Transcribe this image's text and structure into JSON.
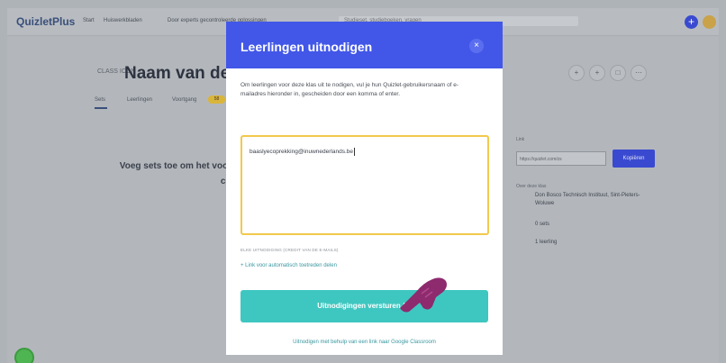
{
  "app": {
    "logo": "QuizletPlus"
  },
  "nav": {
    "links": [
      "Start",
      "Huiswerkbladen",
      "Door experts gecontroleerde oplossingen"
    ],
    "search_placeholder": "Studieset, studieboeken, vragen",
    "plus_icon": "plus-icon"
  },
  "page": {
    "class_icon_text": "CLASS ICON",
    "title": "Naam van de",
    "tabs": [
      "Sets",
      "Leerlingen",
      "Voortgang"
    ],
    "badge": "58",
    "right_icon_glyphs": [
      "+",
      "+",
      "□",
      "⋯"
    ],
    "empty_line1": "Voeg sets toe om het voo",
    "empty_line2": "cont",
    "side_label": "Link",
    "share_link": "https://quizlet.com/zs",
    "copy_label": "Kopiëren",
    "side_sub": "Over deze klas",
    "info": [
      "Don Bosco Technisch Instituut, Sint-Pieters-Woluwe",
      "0 sets",
      "1 leerling"
    ]
  },
  "modal": {
    "title": "Leerlingen uitnodigen",
    "close_glyph": "×",
    "instructions": "Om leerlingen voor deze klas uit te nodigen, vul je hun Quizlet-gebruikersnaam of e-mailadres hieronder in, gescheiden door een komma of enter.",
    "input_value": "baaslyecoprekking@inuwnederlands.be",
    "hint": "ELKE UITNODIGING (CREDIT VAN DE E-MAILS)",
    "auto_join_link": "+ Link voor automatisch toetreden delen",
    "send_label": "Uitnodigingen versturen (1)",
    "classroom_link": "Uitnodigen met behulp van een link naar Google Classroom"
  },
  "colors": {
    "modal_header": "#4257e8",
    "send_button": "#3ec7c0",
    "input_border": "#f2c94c",
    "hand_pointer": "#8e2a6e"
  }
}
